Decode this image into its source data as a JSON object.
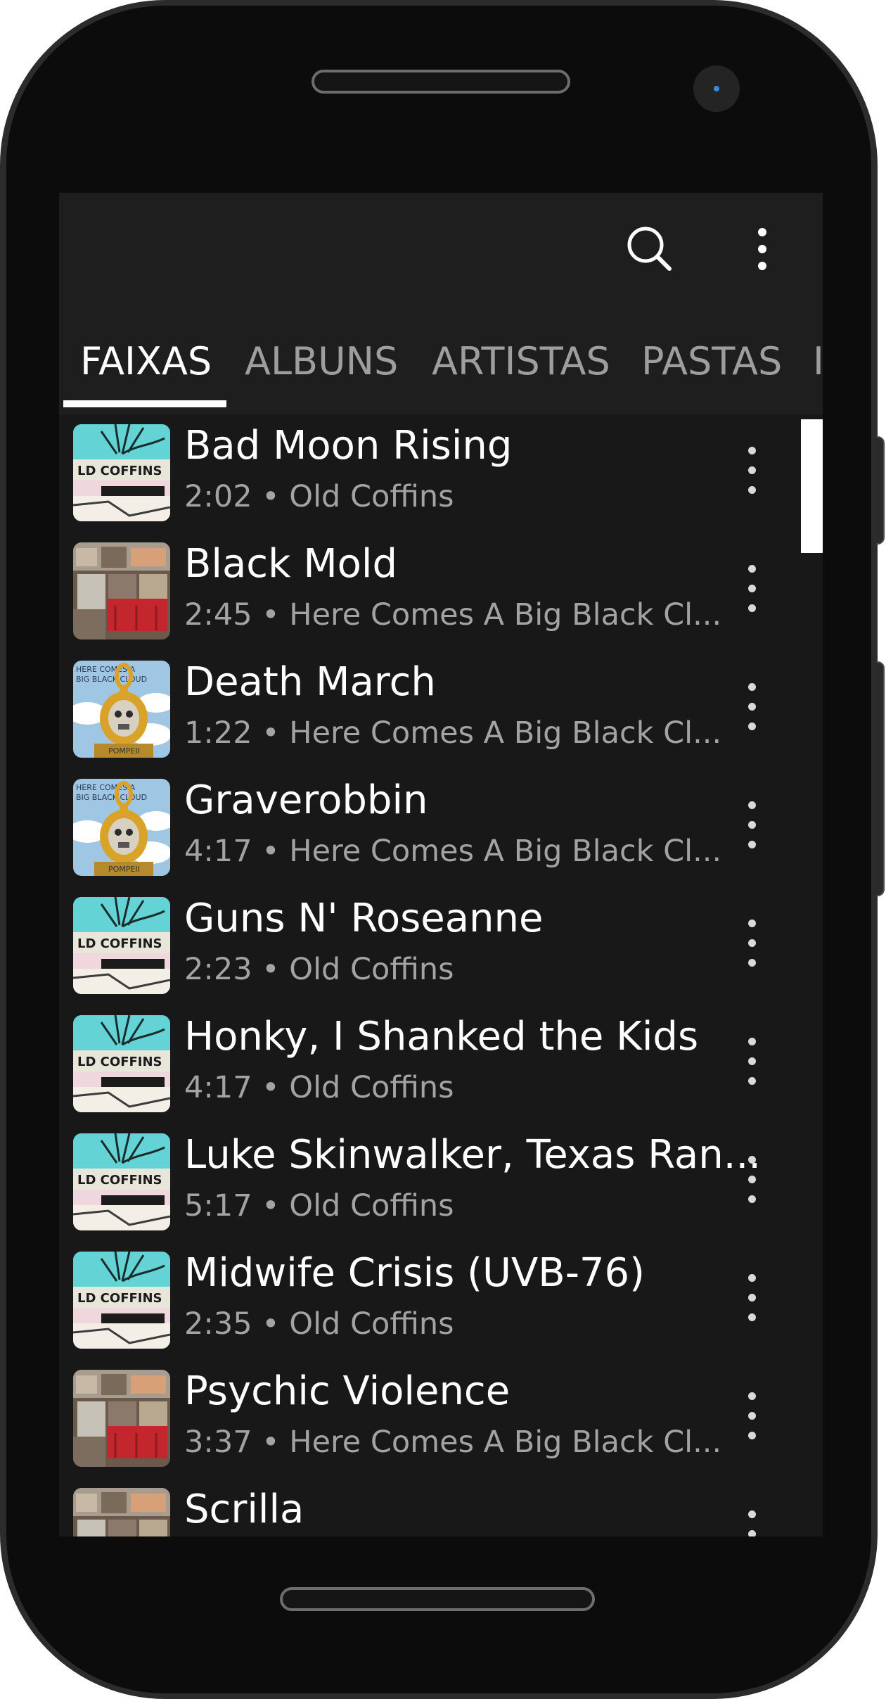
{
  "toolbar": {
    "search_icon": "search-icon",
    "more_icon": "more-vert-icon"
  },
  "tabs": [
    {
      "label": "FAIXAS",
      "active": true
    },
    {
      "label": "ALBUNS",
      "active": false
    },
    {
      "label": "ARTISTAS",
      "active": false
    },
    {
      "label": "PASTAS",
      "active": false
    },
    {
      "label": "I",
      "active": false
    }
  ],
  "tracks": [
    {
      "title": "Bad Moon Rising",
      "subtitle": "2:02 • Old Coffins",
      "art": "old-coffins"
    },
    {
      "title": "Black Mold",
      "subtitle": "2:45 • Here Comes A Big Black Cl...",
      "art": "record-crates"
    },
    {
      "title": "Death March",
      "subtitle": "1:22 • Here Comes A Big Black Cl...",
      "art": "big-black-cloud"
    },
    {
      "title": "Graverobbin",
      "subtitle": "4:17 • Here Comes A Big Black Cl...",
      "art": "big-black-cloud"
    },
    {
      "title": "Guns N' Roseanne",
      "subtitle": "2:23 • Old Coffins",
      "art": "old-coffins"
    },
    {
      "title": "Honky, I Shanked the Kids",
      "subtitle": "4:17 • Old Coffins",
      "art": "old-coffins"
    },
    {
      "title": "Luke Skinwalker, Texas Ran...",
      "subtitle": "5:17 • Old Coffins",
      "art": "old-coffins"
    },
    {
      "title": "Midwife Crisis (UVB-76)",
      "subtitle": "2:35 • Old Coffins",
      "art": "old-coffins"
    },
    {
      "title": "Psychic Violence",
      "subtitle": "3:37 • Here Comes A Big Black Cl...",
      "art": "record-crates"
    },
    {
      "title": "Scrilla",
      "subtitle": "",
      "art": "record-crates"
    }
  ],
  "art_labels": {
    "old_coffins": "LD COFFINS",
    "big_black_cloud": "POMPEII"
  },
  "colors": {
    "screen_bg": "#181818",
    "toolbar_bg": "#1e1e1e",
    "text_primary": "#ffffff",
    "text_secondary": "#a3a3a3",
    "tab_inactive": "#9e9e9e"
  }
}
